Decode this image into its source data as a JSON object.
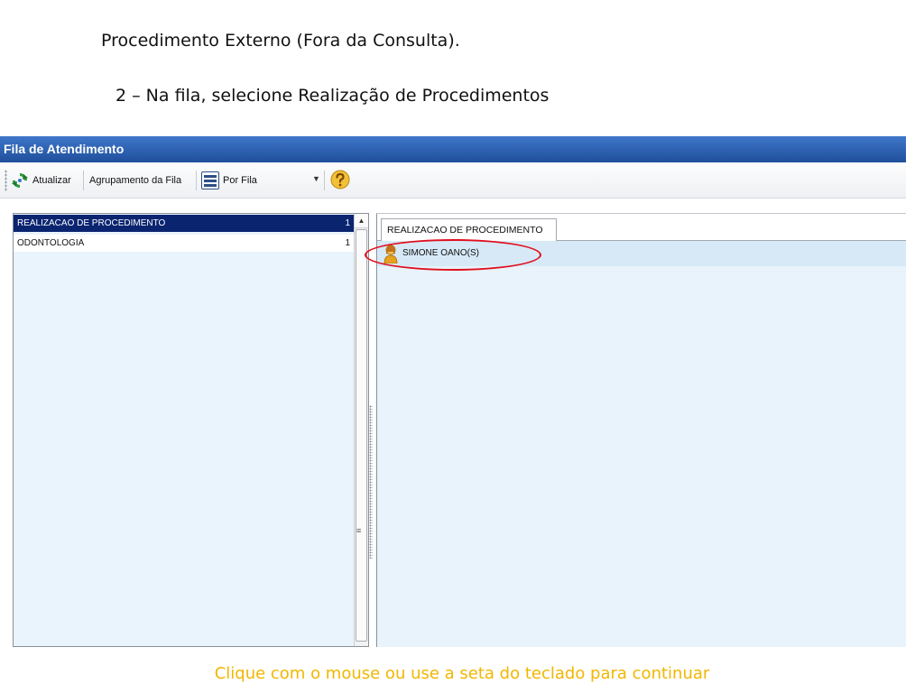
{
  "slide": {
    "title": "Procedimento Externo (Fora da Consulta).",
    "step": "2 – Na fila, selecione Realização de Procedimentos",
    "footer": "Clique com o mouse ou use a seta do teclado para continuar"
  },
  "window": {
    "title": "Fila de Atendimento"
  },
  "toolbar": {
    "refresh_label": "Atualizar",
    "grouping_label": "Agrupamento da Fila",
    "group_mode_value": "Por Fila",
    "icons": [
      "refresh-icon",
      "list-icon",
      "chevron-down-icon",
      "help-icon"
    ]
  },
  "queues": [
    {
      "name": "REALIZACAO DE PROCEDIMENTO",
      "count": "1",
      "selected": true
    },
    {
      "name": "ODONTOLOGIA",
      "count": "1",
      "selected": false
    }
  ],
  "queue_tab": {
    "label": "REALIZACAO DE PROCEDIMENTO"
  },
  "patients": [
    {
      "name": "SIMONE  OANO(S)"
    }
  ],
  "colors": {
    "titlebar": "#1f4f9c",
    "selected_row": "#0a2470",
    "highlight": "#e0101e",
    "footer_text": "#f2b600"
  }
}
